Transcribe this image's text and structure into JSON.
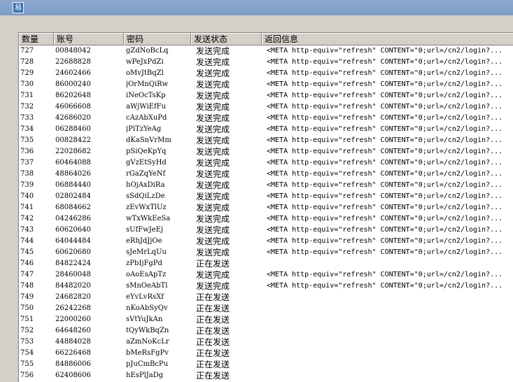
{
  "window": {
    "icon_glyph": "易"
  },
  "table": {
    "columns": [
      "数量",
      "账号",
      "密码",
      "发送状态",
      "返回信息"
    ],
    "rows": [
      [
        "727",
        "00848042",
        "gZdNoBcLq",
        "发送完成",
        "<META http-equiv=\"refresh\" CONTENT=\"0;url=/cn2/login?..."
      ],
      [
        "728",
        "22688828",
        "wPeJxPdZi",
        "发送完成",
        "<META http-equiv=\"refresh\" CONTENT=\"0;url=/cn2/login?..."
      ],
      [
        "729",
        "24602466",
        "oMvJtBqZl",
        "发送完成",
        "<META http-equiv=\"refresh\" CONTENT=\"0;url=/cn2/login?..."
      ],
      [
        "730",
        "86000240",
        "jOrMnQiRw",
        "发送完成",
        "<META http-equiv=\"refresh\" CONTENT=\"0;url=/cn2/login?..."
      ],
      [
        "731",
        "86202648",
        "iNeOcTsKp",
        "发送完成",
        "<META http-equiv=\"refresh\" CONTENT=\"0;url=/cn2/login?..."
      ],
      [
        "732",
        "46066608",
        "aWjWiEfFu",
        "发送完成",
        "<META http-equiv=\"refresh\" CONTENT=\"0;url=/cn2/login?..."
      ],
      [
        "733",
        "42686020",
        "cAzAbXuPd",
        "发送完成",
        "<META http-equiv=\"refresh\" CONTENT=\"0;url=/cn2/login?..."
      ],
      [
        "734",
        "06288460",
        "jPiTzYeAg",
        "发送完成",
        "<META http-equiv=\"refresh\" CONTENT=\"0;url=/cn2/login?..."
      ],
      [
        "735",
        "00828422",
        "dKaSnVrMm",
        "发送完成",
        "<META http-equiv=\"refresh\" CONTENT=\"0;url=/cn2/login?..."
      ],
      [
        "736",
        "22028682",
        "pSiQeKpYq",
        "发送完成",
        "<META http-equiv=\"refresh\" CONTENT=\"0;url=/cn2/login?..."
      ],
      [
        "737",
        "60464088",
        "gVzEtSyHd",
        "发送完成",
        "<META http-equiv=\"refresh\" CONTENT=\"0;url=/cn2/login?..."
      ],
      [
        "738",
        "48864026",
        "rGaZqYeNf",
        "发送完成",
        "<META http-equiv=\"refresh\" CONTENT=\"0;url=/cn2/login?..."
      ],
      [
        "739",
        "06884440",
        "hOjAxDiRa",
        "发送完成",
        "<META http-equiv=\"refresh\" CONTENT=\"0;url=/cn2/login?..."
      ],
      [
        "740",
        "02802484",
        "sSdQiLzDe",
        "发送完成",
        "<META http-equiv=\"refresh\" CONTENT=\"0;url=/cn2/login?..."
      ],
      [
        "741",
        "68084662",
        "zEvWxTlUz",
        "发送完成",
        "<META http-equiv=\"refresh\" CONTENT=\"0;url=/cn2/login?..."
      ],
      [
        "742",
        "04246286",
        "wTxWkEeSa",
        "发送完成",
        "<META http-equiv=\"refresh\" CONTENT=\"0;url=/cn2/login?..."
      ],
      [
        "743",
        "60620640",
        "sUfFwJeEj",
        "发送完成",
        "<META http-equiv=\"refresh\" CONTENT=\"0;url=/cn2/login?..."
      ],
      [
        "744",
        "64044484",
        "eRhJdJjOe",
        "发送完成",
        "<META http-equiv=\"refresh\" CONTENT=\"0;url=/cn2/login?..."
      ],
      [
        "745",
        "60620680",
        "sJeMrLqUu",
        "发送完成",
        "<META http-equiv=\"refresh\" CONTENT=\"0;url=/cn2/login?..."
      ],
      [
        "746",
        "84822424",
        "zPbIjFgPd",
        "正在发送",
        ""
      ],
      [
        "747",
        "28460048",
        "oAoEsApTz",
        "发送完成",
        "<META http-equiv=\"refresh\" CONTENT=\"0;url=/cn2/login?..."
      ],
      [
        "748",
        "84482020",
        "sMnOeAbTl",
        "发送完成",
        "<META http-equiv=\"refresh\" CONTENT=\"0;url=/cn2/login?..."
      ],
      [
        "749",
        "24682820",
        "eYvLvRsXf",
        "正在发送",
        ""
      ],
      [
        "750",
        "26242268",
        "nKoAbSyQv",
        "正在发送",
        ""
      ],
      [
        "751",
        "22000260",
        "sVtYuJkAn",
        "正在发送",
        ""
      ],
      [
        "752",
        "64648260",
        "tQyWkBqZn",
        "正在发送",
        ""
      ],
      [
        "753",
        "44884028",
        "aZmNoKcLr",
        "正在发送",
        ""
      ],
      [
        "754",
        "66226468",
        "bMeRsFgPv",
        "正在发送",
        ""
      ],
      [
        "755",
        "84886006",
        "pJuCmBcPu",
        "正在发送",
        ""
      ],
      [
        "756",
        "62408606",
        "hEsPlJaDg",
        "正在发送",
        ""
      ]
    ]
  }
}
